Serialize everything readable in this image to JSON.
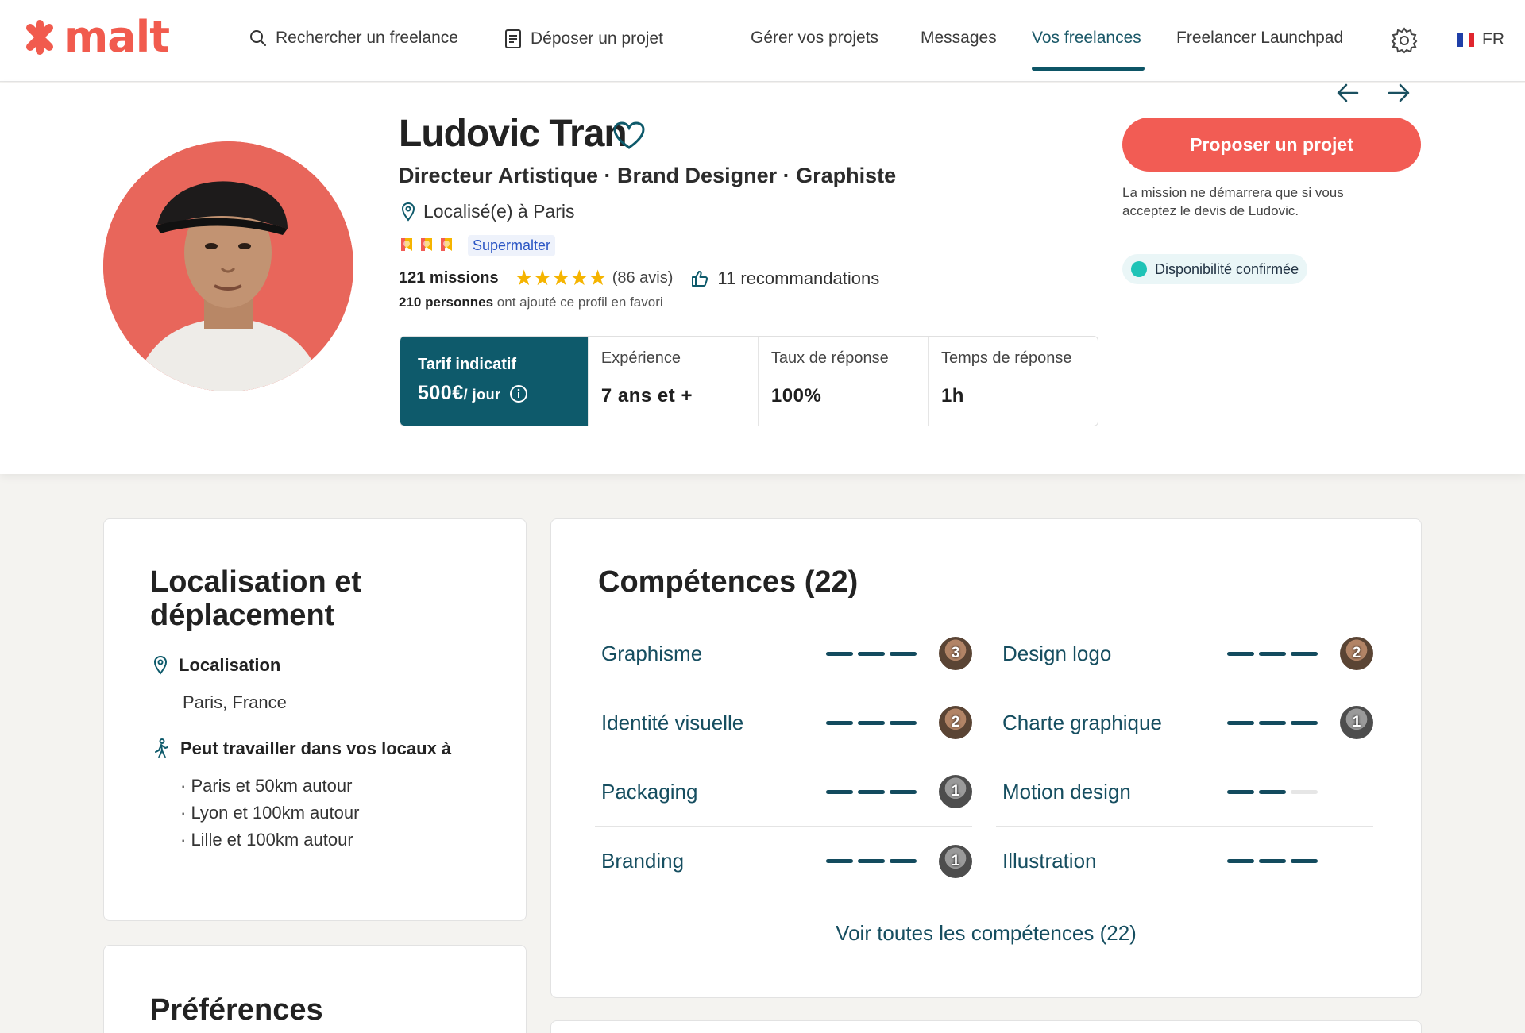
{
  "nav": {
    "logo_text": "malt",
    "search_label": "Rechercher un freelance",
    "post_label": "Déposer un projet",
    "manage_label": "Gérer vos projets",
    "messages_label": "Messages",
    "freelancers_label": "Vos freelances",
    "launchpad_label": "Freelancer Launchpad",
    "lang_label": "FR",
    "active_tab": "Vos freelances"
  },
  "profile": {
    "name": "Ludovic Tran",
    "headline": "Directeur Artistique · Brand Designer · Graphiste",
    "location": "Localisé(e) à Paris",
    "badge": "Supermalter",
    "missions": "121 missions",
    "rating": 5,
    "reviews": "(86 avis)",
    "recommendations": "11 recommandations",
    "favorites_count": "210 personnes",
    "favorites_text": " ont ajouté ce profil en favori"
  },
  "metrics": {
    "rate_label": "Tarif indicatif",
    "rate_value": "500€",
    "rate_unit": "/ jour",
    "experience_label": "Expérience",
    "experience_value": "7 ans et +",
    "response_rate_label": "Taux de réponse",
    "response_rate_value": "100%",
    "response_time_label": "Temps de réponse",
    "response_time_value": "1h"
  },
  "cta": {
    "label": "Proposer un projet",
    "note": "La mission ne démarrera que si vous acceptez le devis de Ludovic.",
    "availability": "Disponibilité confirmée"
  },
  "location_card": {
    "title": "Localisation et déplacement",
    "loc_label": "Localisation",
    "loc_value": "Paris, France",
    "travel_label": "Peut travailler dans vos locaux à",
    "travel_items": [
      "· Paris et 50km autour",
      "· Lyon et 100km autour",
      "· Lille et 100km autour"
    ]
  },
  "preferences_card": {
    "title": "Préférences"
  },
  "skills_card": {
    "title": "Compétences (22)",
    "skills": [
      {
        "name": "Graphisme",
        "level": 3,
        "endorsements": "3"
      },
      {
        "name": "Design logo",
        "level": 3,
        "endorsements": "2"
      },
      {
        "name": "Identité visuelle",
        "level": 3,
        "endorsements": "2"
      },
      {
        "name": "Charte graphique",
        "level": 3,
        "endorsements": "1"
      },
      {
        "name": "Packaging",
        "level": 3,
        "endorsements": "1"
      },
      {
        "name": "Motion design",
        "level": 2,
        "endorsements": ""
      },
      {
        "name": "Branding",
        "level": 3,
        "endorsements": "1"
      },
      {
        "name": "Illustration",
        "level": 3,
        "endorsements": ""
      }
    ],
    "see_all": "Voir toutes les compétences (22)"
  },
  "colors": {
    "brand": "#f15b4e",
    "teal": "#0e5a6b",
    "skill_text": "#164e60",
    "availability_dot": "#1fc3b6"
  }
}
